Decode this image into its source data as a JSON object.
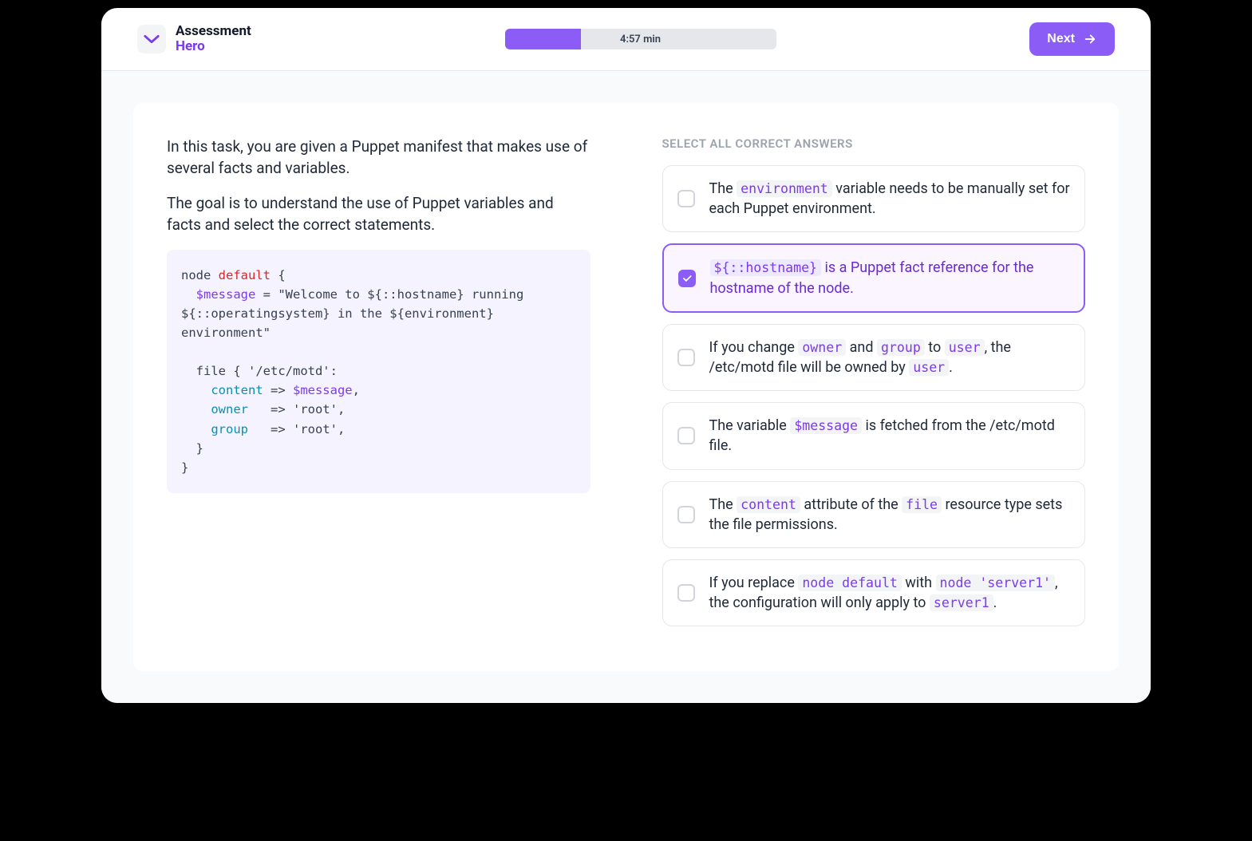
{
  "header": {
    "brand_line1": "Assessment",
    "brand_line2": "Hero",
    "timer": "4:57 min",
    "next_label": "Next"
  },
  "task": {
    "intro1": "In this task, you are given a Puppet manifest that makes use of several facts and variables.",
    "intro2": "The goal is to understand the use of Puppet variables and facts and select the correct statements.",
    "code": {
      "l1a": "node ",
      "l1b": "default",
      "l1c": " {",
      "l2a": "  ",
      "l2b": "$message",
      "l2c": " = \"Welcome to ${::hostname} running ${::operatingsystem} in the ${environment} environment\"",
      "l3": "",
      "l4": "  file { '/etc/motd':",
      "l5a": "    ",
      "l5b": "content",
      "l5c": " => ",
      "l5d": "$message",
      "l5e": ",",
      "l6a": "    ",
      "l6b": "owner",
      "l6c": "   => 'root',",
      "l7a": "    ",
      "l7b": "group",
      "l7c": "   => 'root',",
      "l8": "  }",
      "l9": "}"
    }
  },
  "answers": {
    "heading": "SELECT ALL CORRECT ANSWERS",
    "a1": {
      "p1": "The ",
      "c1": "environment",
      "p2": " variable needs to be manually set for each Puppet environment.",
      "checked": false
    },
    "a2": {
      "c1": "${::hostname}",
      "p1": " is a Puppet fact reference for the hostname of the node.",
      "checked": true
    },
    "a3": {
      "p1": "If you change ",
      "c1": "owner",
      "p2": " and ",
      "c2": "group",
      "p3": " to ",
      "c3": "user",
      "p4": ", the /etc/motd file will be owned by ",
      "c4": "user",
      "p5": ".",
      "checked": false
    },
    "a4": {
      "p1": "The variable ",
      "c1": "$message",
      "p2": " is fetched from the /etc/motd file.",
      "checked": false
    },
    "a5": {
      "p1": "The ",
      "c1": "content",
      "p2": " attribute of the ",
      "c2": "file",
      "p3": " resource type sets the file permissions.",
      "checked": false
    },
    "a6": {
      "p1": "If you replace ",
      "c1": "node default",
      "p2": " with ",
      "c2": "node 'server1'",
      "p3": ", the configuration will only apply to ",
      "c3": "server1",
      "p4": ".",
      "checked": false
    }
  }
}
